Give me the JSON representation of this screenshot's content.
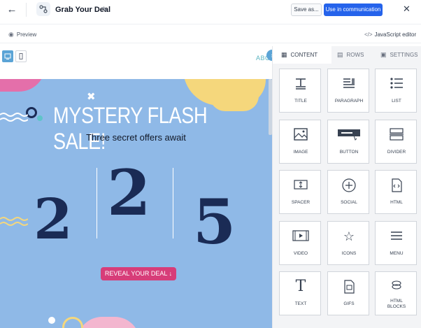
{
  "topbar": {
    "back_icon": "arrow-left-icon",
    "title": "Grab Your Deal",
    "save_as": "Save as...",
    "use_in_communication": "Use in communication",
    "close_icon": "close-icon"
  },
  "toolbar": {
    "preview": "Preview",
    "javascript_editor": "JavaScript editor"
  },
  "canvas": {
    "about_text": "ABOU",
    "headline": "MYSTERY FLASH SALE!",
    "subhead": "Three secret offers await",
    "digits": [
      "2",
      "2",
      "5"
    ],
    "reveal_button": "REVEAL YOUR DEAL ↓",
    "colors": {
      "background": "#8fb9e7",
      "accent": "#d73d79",
      "digits": "#1a2b55"
    }
  },
  "sidebar": {
    "tabs": [
      {
        "label": "CONTENT",
        "icon": "grid-icon",
        "active": true
      },
      {
        "label": "ROWS",
        "icon": "rows-icon",
        "active": false
      },
      {
        "label": "SETTINGS",
        "icon": "settings-icon",
        "active": false
      }
    ],
    "blocks": [
      {
        "label": "TITLE",
        "icon": "title-icon"
      },
      {
        "label": "PARAGRAPH",
        "icon": "paragraph-icon"
      },
      {
        "label": "LIST",
        "icon": "list-icon"
      },
      {
        "label": "IMAGE",
        "icon": "image-icon"
      },
      {
        "label": "BUTTON",
        "icon": "button-icon"
      },
      {
        "label": "DIVIDER",
        "icon": "divider-icon"
      },
      {
        "label": "SPACER",
        "icon": "spacer-icon"
      },
      {
        "label": "SOCIAL",
        "icon": "social-icon"
      },
      {
        "label": "HTML",
        "icon": "html-icon"
      },
      {
        "label": "VIDEO",
        "icon": "video-icon"
      },
      {
        "label": "ICONS",
        "icon": "star-icon"
      },
      {
        "label": "MENU",
        "icon": "menu-icon"
      },
      {
        "label": "TEXT",
        "icon": "text-icon"
      },
      {
        "label": "GIFS",
        "icon": "gif-icon"
      },
      {
        "label": "HTML\nBLOCKS",
        "icon": "html-blocks-icon"
      }
    ]
  }
}
